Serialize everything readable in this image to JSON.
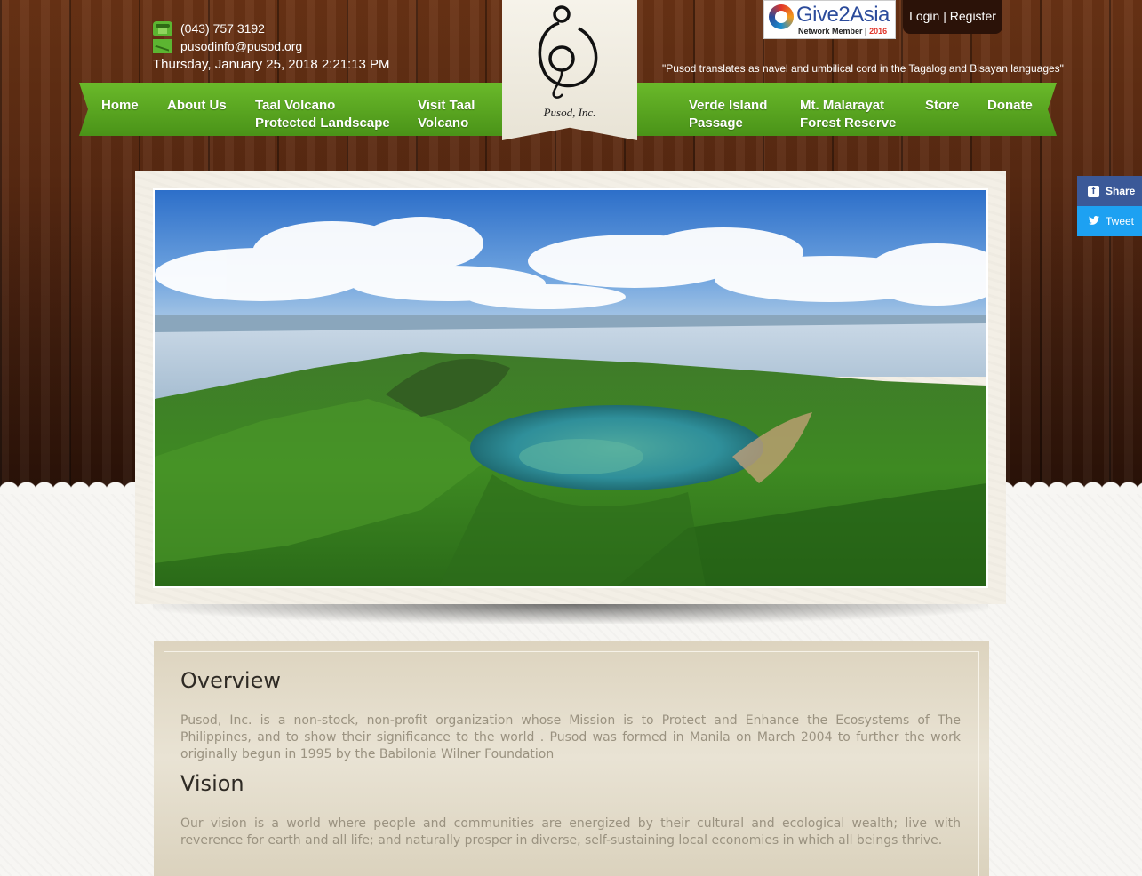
{
  "contact": {
    "phone": "(043) 757 3192",
    "email": "pusodinfo@pusod.org",
    "datetime": "Thursday, January 25, 2018 2:21:13 PM",
    "phone_icon": "phone-icon",
    "email_icon": "envelope-icon"
  },
  "logo": {
    "name": "Pusod, Inc."
  },
  "partner": {
    "brand": "Give2Asia",
    "sub_left": "Network Member",
    "sub_right": "2016"
  },
  "auth": {
    "login": "Login",
    "separator": " | ",
    "register": "Register"
  },
  "tagline": "\"Pusod translates as navel and umbilical cord in the Tagalog and Bisayan languages\"",
  "nav": {
    "home": "Home",
    "about": "About Us",
    "taal_line1": "Taal Volcano",
    "taal_line2": "Protected Landscape",
    "visit_line1": "Visit Taal",
    "visit_line2": "Volcano",
    "verde_line1": "Verde Island",
    "verde_line2": "Passage",
    "malarayat_line1": "Mt. Malarayat",
    "malarayat_line2": "Forest Reserve",
    "store": "Store",
    "donate": "Donate"
  },
  "share": {
    "facebook": "Share",
    "twitter": "Tweet"
  },
  "overview": {
    "title": "Overview",
    "text": "Pusod, Inc. is a non-stock, non-profit organization whose Mission is to Protect and Enhance the Ecosystems of The Philippines, and to show their significance to the world . Pusod was formed in Manila on March 2004 to further the work originally begun in 1995 by the Babilonia Wilner Foundation"
  },
  "vision": {
    "title": "Vision",
    "text": "Our vision is a world where people and communities are energized by their cultural and ecological wealth; live with reverence for earth and all life; and naturally prosper in diverse, self-sustaining local economies in which all beings thrive."
  },
  "colors": {
    "nav_green": "#5aa822",
    "wood": "#5a2a12",
    "facebook": "#3b5998",
    "twitter": "#1da1f2"
  }
}
